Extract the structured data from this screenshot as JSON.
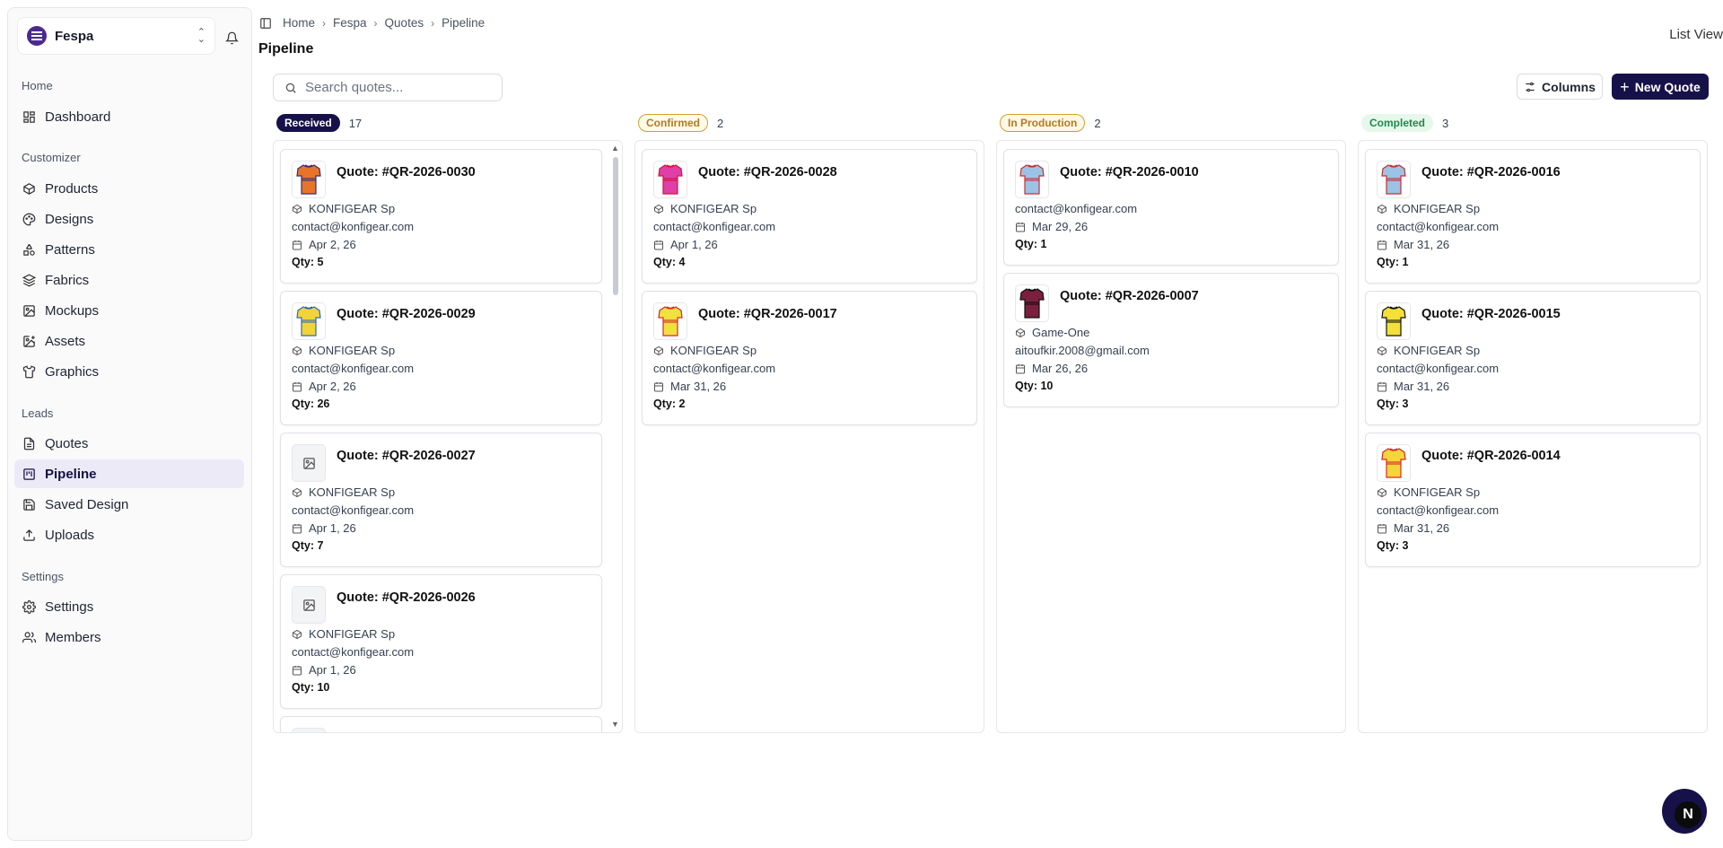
{
  "org": {
    "name": "Fespa"
  },
  "sidebar": {
    "sections": [
      {
        "label": "Home",
        "items": [
          {
            "label": "Dashboard",
            "icon": "dashboard-icon"
          }
        ]
      },
      {
        "label": "Customizer",
        "items": [
          {
            "label": "Products",
            "icon": "box-icon"
          },
          {
            "label": "Designs",
            "icon": "palette-icon"
          },
          {
            "label": "Patterns",
            "icon": "shapes-icon"
          },
          {
            "label": "Fabrics",
            "icon": "layers-icon"
          },
          {
            "label": "Mockups",
            "icon": "image-icon"
          },
          {
            "label": "Assets",
            "icon": "image-plus-icon"
          },
          {
            "label": "Graphics",
            "icon": "shirt-icon"
          }
        ]
      },
      {
        "label": "Leads",
        "items": [
          {
            "label": "Quotes",
            "icon": "file-icon"
          },
          {
            "label": "Pipeline",
            "icon": "kanban-icon",
            "active": true
          },
          {
            "label": "Saved Design",
            "icon": "save-icon"
          },
          {
            "label": "Uploads",
            "icon": "upload-icon"
          }
        ]
      },
      {
        "label": "Settings",
        "items": [
          {
            "label": "Settings",
            "icon": "gear-icon"
          },
          {
            "label": "Members",
            "icon": "users-icon"
          }
        ]
      }
    ]
  },
  "breadcrumb": [
    "Home",
    "Fespa",
    "Quotes",
    "Pipeline"
  ],
  "page_title": "Pipeline",
  "view_toggle": "List View",
  "search": {
    "placeholder": "Search quotes..."
  },
  "toolbar": {
    "columns_label": "Columns",
    "new_quote_label": "New Quote"
  },
  "colors": {
    "accent": "#17114a"
  },
  "columns": [
    {
      "status": "Received",
      "count": "17",
      "cards": [
        {
          "title": "Quote: #QR-2026-0030",
          "company": "KONFIGEAR Sp",
          "email": "contact@konfigear.com",
          "date": "Apr 2, 26",
          "qty": "Qty: 5",
          "thumb": "jersey-orange"
        },
        {
          "title": "Quote: #QR-2026-0029",
          "company": "KONFIGEAR Sp",
          "email": "contact@konfigear.com",
          "date": "Apr 2, 26",
          "qty": "Qty: 26",
          "thumb": "jersey-blue-yellow"
        },
        {
          "title": "Quote: #QR-2026-0027",
          "company": "KONFIGEAR Sp",
          "email": "contact@konfigear.com",
          "date": "Apr 1, 26",
          "qty": "Qty: 7",
          "thumb": "placeholder"
        },
        {
          "title": "Quote: #QR-2026-0026",
          "company": "KONFIGEAR Sp",
          "email": "contact@konfigear.com",
          "date": "Apr 1, 26",
          "qty": "Qty: 10",
          "thumb": "placeholder"
        }
      ]
    },
    {
      "status": "Confirmed",
      "count": "2",
      "cards": [
        {
          "title": "Quote: #QR-2026-0028",
          "company": "KONFIGEAR Sp",
          "email": "contact@konfigear.com",
          "date": "Apr 1, 26",
          "qty": "Qty: 4",
          "thumb": "jersey-pink"
        },
        {
          "title": "Quote: #QR-2026-0017",
          "company": "KONFIGEAR Sp",
          "email": "contact@konfigear.com",
          "date": "Mar 31, 26",
          "qty": "Qty: 2",
          "thumb": "jersey-yellow-red"
        }
      ]
    },
    {
      "status": "In Production",
      "count": "2",
      "cards": [
        {
          "title": "Quote: #QR-2026-0010",
          "company": "",
          "email": "contact@konfigear.com",
          "date": "Mar 29, 26",
          "qty": "Qty: 1",
          "thumb": "jersey-light-blue"
        },
        {
          "title": "Quote: #QR-2026-0007",
          "company": "Game-One",
          "email": "aitoufkir.2008@gmail.com",
          "date": "Mar 26, 26",
          "qty": "Qty: 10",
          "thumb": "jersey-maroon"
        }
      ]
    },
    {
      "status": "Completed",
      "count": "3",
      "cards": [
        {
          "title": "Quote: #QR-2026-0016",
          "company": "KONFIGEAR Sp",
          "email": "contact@konfigear.com",
          "date": "Mar 31, 26",
          "qty": "Qty: 1",
          "thumb": "jersey-light-blue"
        },
        {
          "title": "Quote: #QR-2026-0015",
          "company": "KONFIGEAR Sp",
          "email": "contact@konfigear.com",
          "date": "Mar 31, 26",
          "qty": "Qty: 3",
          "thumb": "jersey-yellow-black"
        },
        {
          "title": "Quote: #QR-2026-0014",
          "company": "KONFIGEAR Sp",
          "email": "contact@konfigear.com",
          "date": "Mar 31, 26",
          "qty": "Qty: 3",
          "thumb": "jersey-yellow"
        }
      ]
    }
  ],
  "fab": {
    "label": "N"
  }
}
